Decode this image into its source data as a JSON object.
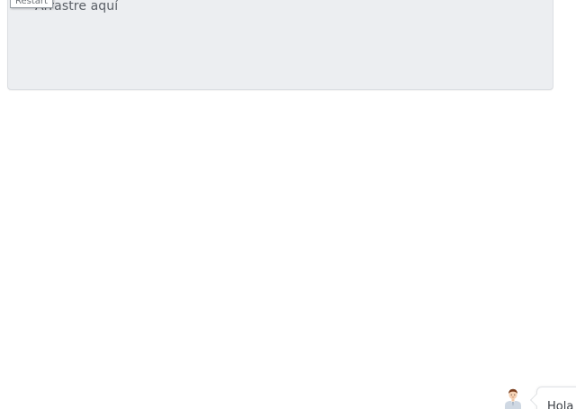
{
  "drop_zone": {
    "label": "Arrastre aquí",
    "background_color": "#eceef1"
  },
  "restart_button": {
    "label": "Restart"
  },
  "assistant": {
    "avatar_icon": "person-avatar-icon",
    "greeting": "Hola"
  }
}
